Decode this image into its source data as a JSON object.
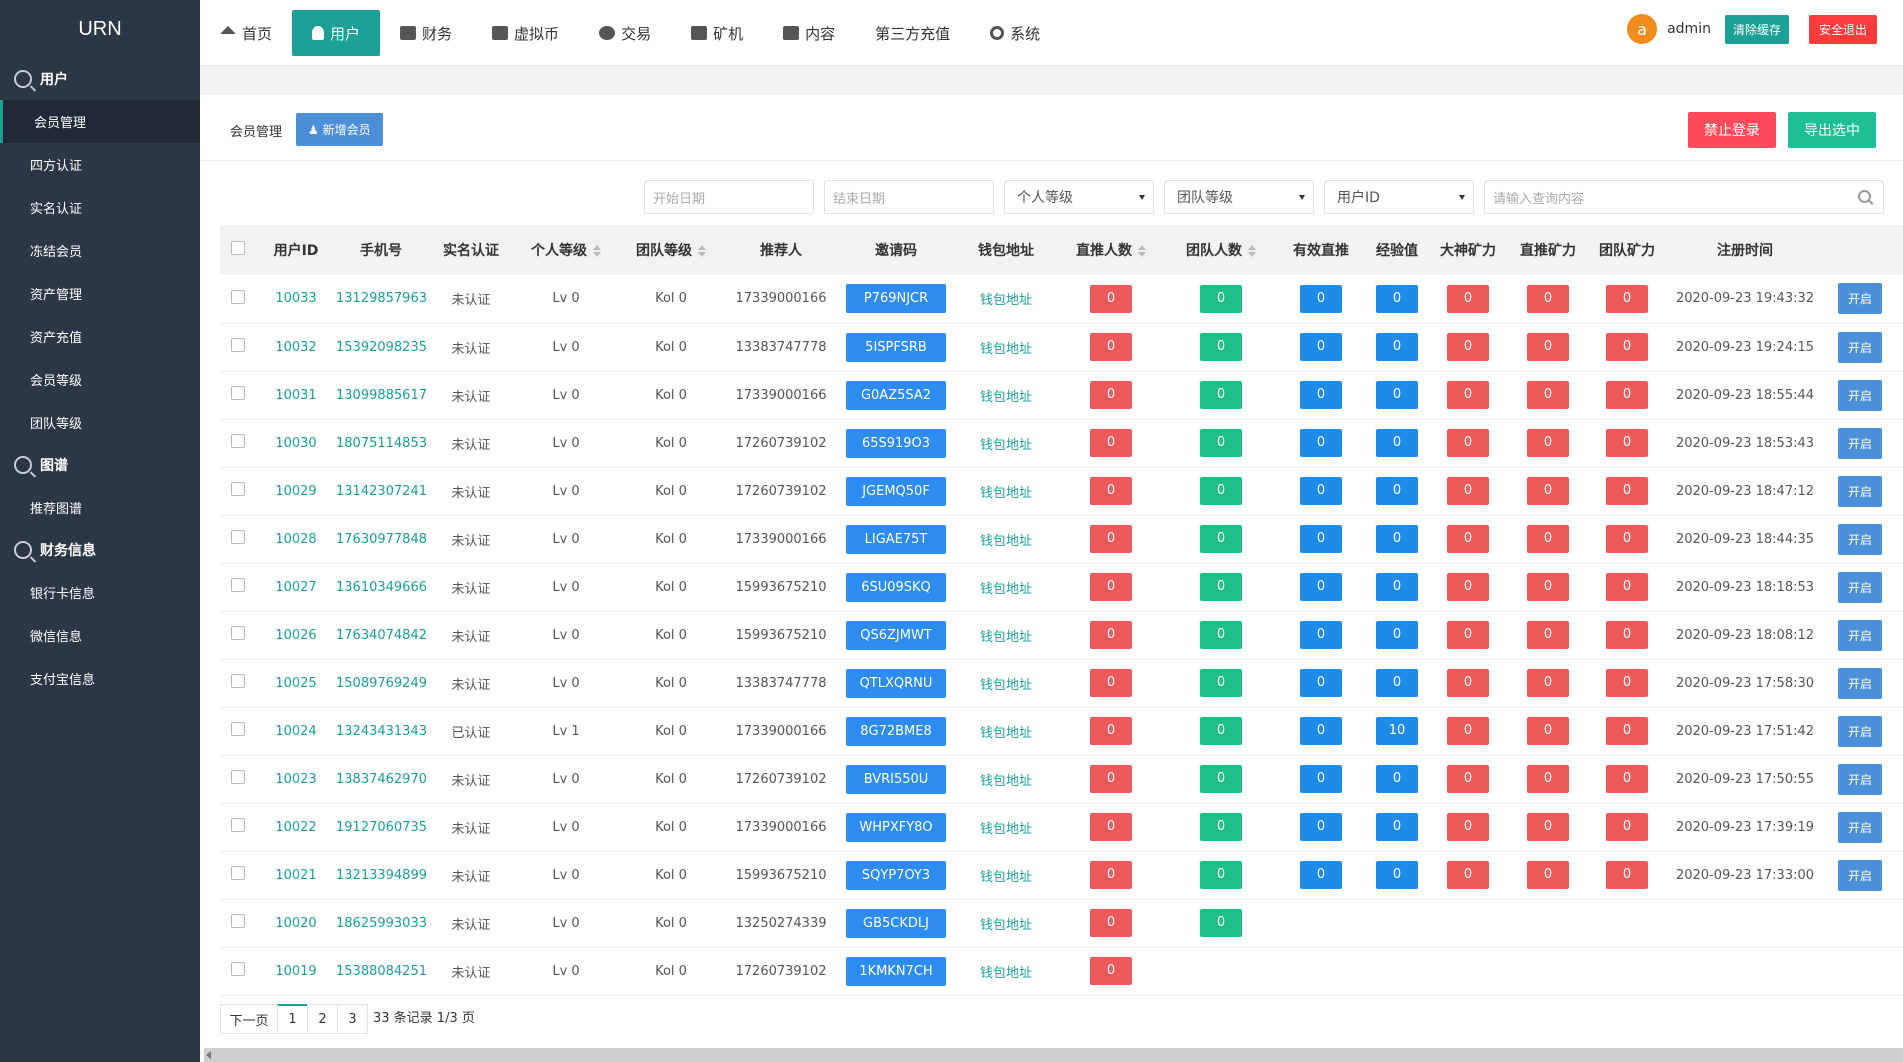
{
  "sidebar": {
    "logo": "URN",
    "groups": [
      {
        "title": "用户",
        "items": [
          "会员管理",
          "四方认证",
          "实名认证",
          "冻结会员",
          "资产管理",
          "资产充值",
          "会员等级",
          "团队等级"
        ]
      },
      {
        "title": "图谱",
        "items": [
          "推荐图谱"
        ]
      },
      {
        "title": "财务信息",
        "items": [
          "银行卡信息",
          "微信信息",
          "支付宝信息"
        ]
      }
    ]
  },
  "topnav": {
    "items": [
      "首页",
      "用户",
      "财务",
      "虚拟币",
      "交易",
      "矿机",
      "内容",
      "第三方充值",
      "系统"
    ],
    "avatar_letter": "a",
    "admin_name": "admin",
    "clear_cache": "清除缓存",
    "logout": "安全退出"
  },
  "page": {
    "breadcrumb": "会员管理",
    "add_member": "新增会员",
    "ban_login": "禁止登录",
    "export_selected": "导出选中"
  },
  "filters": {
    "start_date": "开始日期",
    "end_date": "结束日期",
    "personal_level": "个人等级",
    "team_level": "团队等级",
    "user_id": "用户ID",
    "search_placeholder": "请输入查询内容"
  },
  "table": {
    "headers": [
      "用户ID",
      "手机号",
      "实名认证",
      "个人等级",
      "团队等级",
      "推荐人",
      "邀请码",
      "钱包地址",
      "直推人数",
      "团队人数",
      "有效直推",
      "经验值",
      "大神矿力",
      "直推矿力",
      "团队矿力",
      "注册时间"
    ],
    "wallet_label": "钱包地址",
    "open_label": "开启",
    "rows": [
      {
        "id": "10033",
        "phone": "13129857963",
        "auth": "未认证",
        "plv": "Lv 0",
        "tlv": "Kol 0",
        "ref": "17339000166",
        "code": "P769NJCR",
        "d": "0",
        "t": "0",
        "v": "0",
        "exp": "0",
        "g": "0",
        "dp": "0",
        "tp": "0",
        "time": "2020-09-23 19:43:32"
      },
      {
        "id": "10032",
        "phone": "15392098235",
        "auth": "未认证",
        "plv": "Lv 0",
        "tlv": "Kol 0",
        "ref": "13383747778",
        "code": "5ISPFSRB",
        "d": "0",
        "t": "0",
        "v": "0",
        "exp": "0",
        "g": "0",
        "dp": "0",
        "tp": "0",
        "time": "2020-09-23 19:24:15"
      },
      {
        "id": "10031",
        "phone": "13099885617",
        "auth": "未认证",
        "plv": "Lv 0",
        "tlv": "Kol 0",
        "ref": "17339000166",
        "code": "G0AZ5SA2",
        "d": "0",
        "t": "0",
        "v": "0",
        "exp": "0",
        "g": "0",
        "dp": "0",
        "tp": "0",
        "time": "2020-09-23 18:55:44"
      },
      {
        "id": "10030",
        "phone": "18075114853",
        "auth": "未认证",
        "plv": "Lv 0",
        "tlv": "Kol 0",
        "ref": "17260739102",
        "code": "65S919O3",
        "d": "0",
        "t": "0",
        "v": "0",
        "exp": "0",
        "g": "0",
        "dp": "0",
        "tp": "0",
        "time": "2020-09-23 18:53:43"
      },
      {
        "id": "10029",
        "phone": "13142307241",
        "auth": "未认证",
        "plv": "Lv 0",
        "tlv": "Kol 0",
        "ref": "17260739102",
        "code": "JGEMQ50F",
        "d": "0",
        "t": "0",
        "v": "0",
        "exp": "0",
        "g": "0",
        "dp": "0",
        "tp": "0",
        "time": "2020-09-23 18:47:12"
      },
      {
        "id": "10028",
        "phone": "17630977848",
        "auth": "未认证",
        "plv": "Lv 0",
        "tlv": "Kol 0",
        "ref": "17339000166",
        "code": "LIGAE75T",
        "d": "0",
        "t": "0",
        "v": "0",
        "exp": "0",
        "g": "0",
        "dp": "0",
        "tp": "0",
        "time": "2020-09-23 18:44:35"
      },
      {
        "id": "10027",
        "phone": "13610349666",
        "auth": "未认证",
        "plv": "Lv 0",
        "tlv": "Kol 0",
        "ref": "15993675210",
        "code": "6SU09SKQ",
        "d": "0",
        "t": "0",
        "v": "0",
        "exp": "0",
        "g": "0",
        "dp": "0",
        "tp": "0",
        "time": "2020-09-23 18:18:53"
      },
      {
        "id": "10026",
        "phone": "17634074842",
        "auth": "未认证",
        "plv": "Lv 0",
        "tlv": "Kol 0",
        "ref": "15993675210",
        "code": "QS6ZJMWT",
        "d": "0",
        "t": "0",
        "v": "0",
        "exp": "0",
        "g": "0",
        "dp": "0",
        "tp": "0",
        "time": "2020-09-23 18:08:12"
      },
      {
        "id": "10025",
        "phone": "15089769249",
        "auth": "未认证",
        "plv": "Lv 0",
        "tlv": "Kol 0",
        "ref": "13383747778",
        "code": "QTLXQRNU",
        "d": "0",
        "t": "0",
        "v": "0",
        "exp": "0",
        "g": "0",
        "dp": "0",
        "tp": "0",
        "time": "2020-09-23 17:58:30"
      },
      {
        "id": "10024",
        "phone": "13243431343",
        "auth": "已认证",
        "plv": "Lv 1",
        "tlv": "Kol 0",
        "ref": "17339000166",
        "code": "8G72BME8",
        "d": "0",
        "t": "0",
        "v": "0",
        "exp": "10",
        "g": "0",
        "dp": "0",
        "tp": "0",
        "time": "2020-09-23 17:51:42"
      },
      {
        "id": "10023",
        "phone": "13837462970",
        "auth": "未认证",
        "plv": "Lv 0",
        "tlv": "Kol 0",
        "ref": "17260739102",
        "code": "BVRI550U",
        "d": "0",
        "t": "0",
        "v": "0",
        "exp": "0",
        "g": "0",
        "dp": "0",
        "tp": "0",
        "time": "2020-09-23 17:50:55"
      },
      {
        "id": "10022",
        "phone": "19127060735",
        "auth": "未认证",
        "plv": "Lv 0",
        "tlv": "Kol 0",
        "ref": "17339000166",
        "code": "WHPXFY8O",
        "d": "0",
        "t": "0",
        "v": "0",
        "exp": "0",
        "g": "0",
        "dp": "0",
        "tp": "0",
        "time": "2020-09-23 17:39:19"
      },
      {
        "id": "10021",
        "phone": "13213394899",
        "auth": "未认证",
        "plv": "Lv 0",
        "tlv": "Kol 0",
        "ref": "15993675210",
        "code": "SQYP7OY3",
        "d": "0",
        "t": "0",
        "v": "0",
        "exp": "0",
        "g": "0",
        "dp": "0",
        "tp": "0",
        "time": "2020-09-23 17:33:00"
      },
      {
        "id": "10020",
        "phone": "18625993033",
        "auth": "未认证",
        "plv": "Lv 0",
        "tlv": "Kol 0",
        "ref": "13250274339",
        "code": "GB5CKDLJ",
        "d": "0",
        "t": "0",
        "v": "",
        "exp": "",
        "g": "",
        "dp": "",
        "tp": "",
        "time": ""
      },
      {
        "id": "10019",
        "phone": "15388084251",
        "auth": "未认证",
        "plv": "Lv 0",
        "tlv": "Kol 0",
        "ref": "17260739102",
        "code": "1KMKN7CH",
        "d": "0",
        "t": "",
        "v": "",
        "exp": "",
        "g": "",
        "dp": "",
        "tp": "",
        "time": ""
      }
    ]
  },
  "pager": {
    "prev": "下一页",
    "pages": [
      "1",
      "2",
      "3"
    ],
    "info": "33 条记录 1/3 页"
  }
}
